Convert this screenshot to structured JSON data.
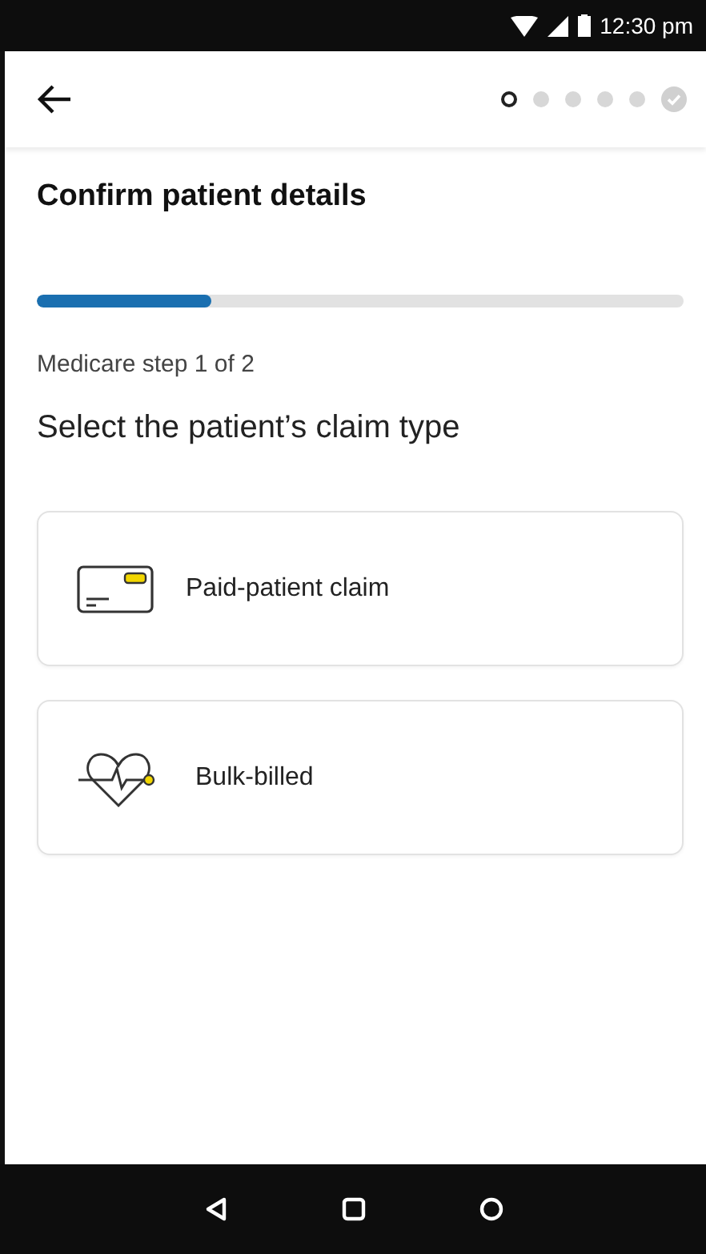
{
  "status_bar": {
    "time": "12:30 pm"
  },
  "header": {
    "steps": [
      {
        "kind": "current"
      },
      {
        "kind": "pending"
      },
      {
        "kind": "pending"
      },
      {
        "kind": "pending"
      },
      {
        "kind": "pending"
      },
      {
        "kind": "final"
      }
    ]
  },
  "title": "Confirm patient details",
  "progress": {
    "level": 0.27
  },
  "step_label": "Medicare step 1 of 2",
  "question": "Select the patient’s claim type",
  "options": [
    {
      "kind": "card",
      "label": "Paid-patient claim"
    },
    {
      "kind": "heart",
      "label": "Bulk-billed"
    }
  ]
}
